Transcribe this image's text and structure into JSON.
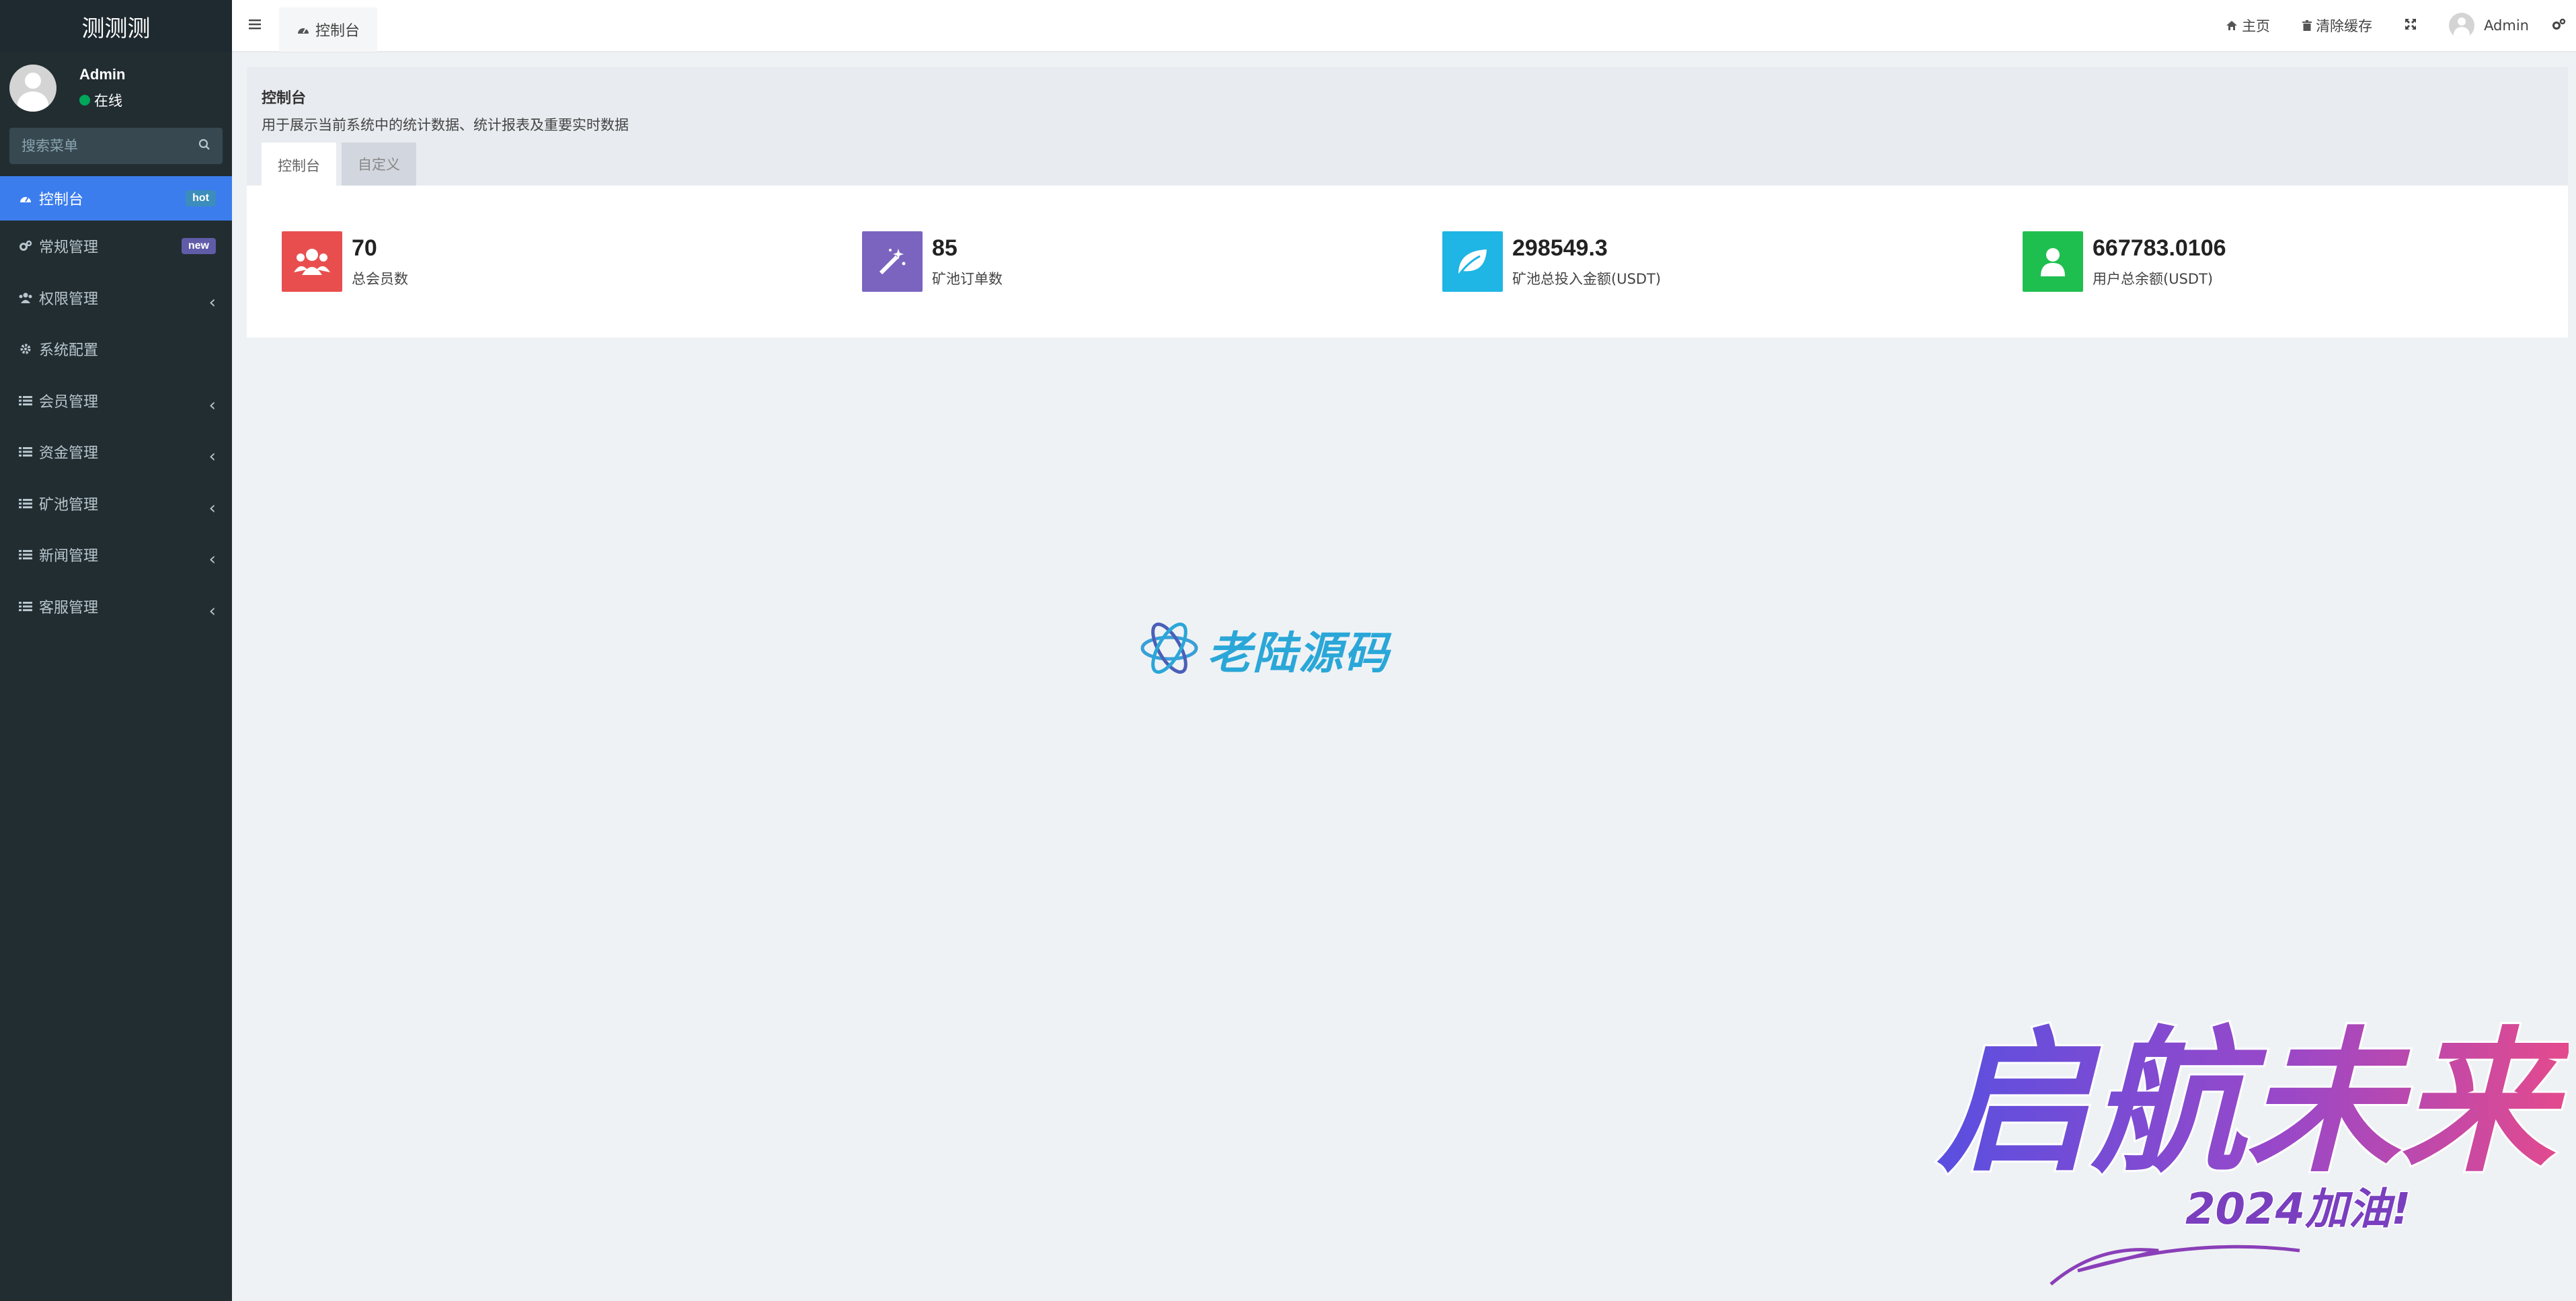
{
  "app": {
    "logo_text": "测测测"
  },
  "user": {
    "name": "Admin",
    "status": "在线"
  },
  "sidebar": {
    "search_placeholder": "搜索菜单",
    "items": [
      {
        "label": "控制台",
        "icon": "dashboard-icon",
        "badge": "hot",
        "active": true
      },
      {
        "label": "常规管理",
        "icon": "cogs-icon",
        "badge": "new"
      },
      {
        "label": "权限管理",
        "icon": "users-icon",
        "expandable": true
      },
      {
        "label": "系统配置",
        "icon": "gear-icon"
      },
      {
        "label": "会员管理",
        "icon": "list-icon",
        "expandable": true
      },
      {
        "label": "资金管理",
        "icon": "list-icon",
        "expandable": true
      },
      {
        "label": "矿池管理",
        "icon": "list-icon",
        "expandable": true
      },
      {
        "label": "新闻管理",
        "icon": "list-icon",
        "expandable": true
      },
      {
        "label": "客服管理",
        "icon": "list-icon",
        "expandable": true
      }
    ]
  },
  "navbar": {
    "tab_label": "控制台",
    "home_label": "主页",
    "clear_cache_label": "清除缓存",
    "user_label": "Admin"
  },
  "panel": {
    "title": "控制台",
    "description": "用于展示当前系统中的统计数据、统计报表及重要实时数据",
    "tabs": [
      "控制台",
      "自定义"
    ]
  },
  "stats": [
    {
      "value": "70",
      "label": "总会员数",
      "color": "#dd4b39",
      "icon": "users-icon"
    },
    {
      "value": "85",
      "label": "矿池订单数",
      "color": "#605ca8",
      "icon": "magic-icon"
    },
    {
      "value": "298549.3",
      "label": "矿池总投入金额(USDT)",
      "color": "#00c0ef",
      "icon": "leaf-icon"
    },
    {
      "value": "667783.0106",
      "label": "用户总余额(USDT)",
      "color": "#00a65a",
      "icon": "user-icon"
    }
  ],
  "watermark": {
    "logo_text": "老陆源码",
    "slogan": "启航未来",
    "slogan_sub": "2024加油!"
  },
  "colors": {
    "sidebar_bg": "#222d32",
    "active_menu": "#3b7ded",
    "content_bg": "#eff2f5"
  }
}
